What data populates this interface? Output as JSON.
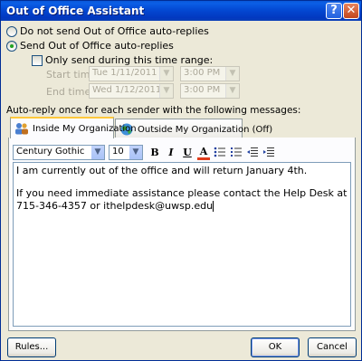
{
  "window": {
    "title": "Out of Office Assistant",
    "help_label": "?",
    "close_label": "✕"
  },
  "options": {
    "do_not_send_label": "Do not send Out of Office auto-replies",
    "send_label": "Send Out of Office auto-replies",
    "selected": "send"
  },
  "time_range": {
    "checkbox_label": "Only send during this time range:",
    "checked": false,
    "start_label": "Start time:",
    "start_date": "Tue 1/11/2011",
    "start_time": "3:00 PM",
    "end_label": "End time:",
    "end_date": "Wed 1/12/2011",
    "end_time": "3:00 PM"
  },
  "autoreply_caption": "Auto-reply once for each sender with the following messages:",
  "tabs": [
    {
      "label": "Inside My Organization",
      "active": true,
      "icon": "people-icon"
    },
    {
      "label": "Outside My Organization (Off)",
      "active": false,
      "icon": "globe-icon"
    }
  ],
  "format_toolbar": {
    "font_family": "Century Gothic",
    "font_size": "10",
    "bold_label": "B",
    "italic_label": "I",
    "underline_label": "U",
    "font_color_label": "A",
    "font_color": "#e03c1c"
  },
  "message": {
    "line1": "I am currently out of the office and will return January 4th.",
    "line2": "If you need immediate assistance please contact the Help Desk at",
    "line3": "715-346-4357 or ithelpdesk@uwsp.edu"
  },
  "footer": {
    "rules_label": "Rules...",
    "ok_label": "OK",
    "cancel_label": "Cancel"
  },
  "colors": {
    "titlebar": "#0346d0",
    "dialog_bg": "#ece9d8",
    "active_tab_accent": "#ffc83c"
  }
}
